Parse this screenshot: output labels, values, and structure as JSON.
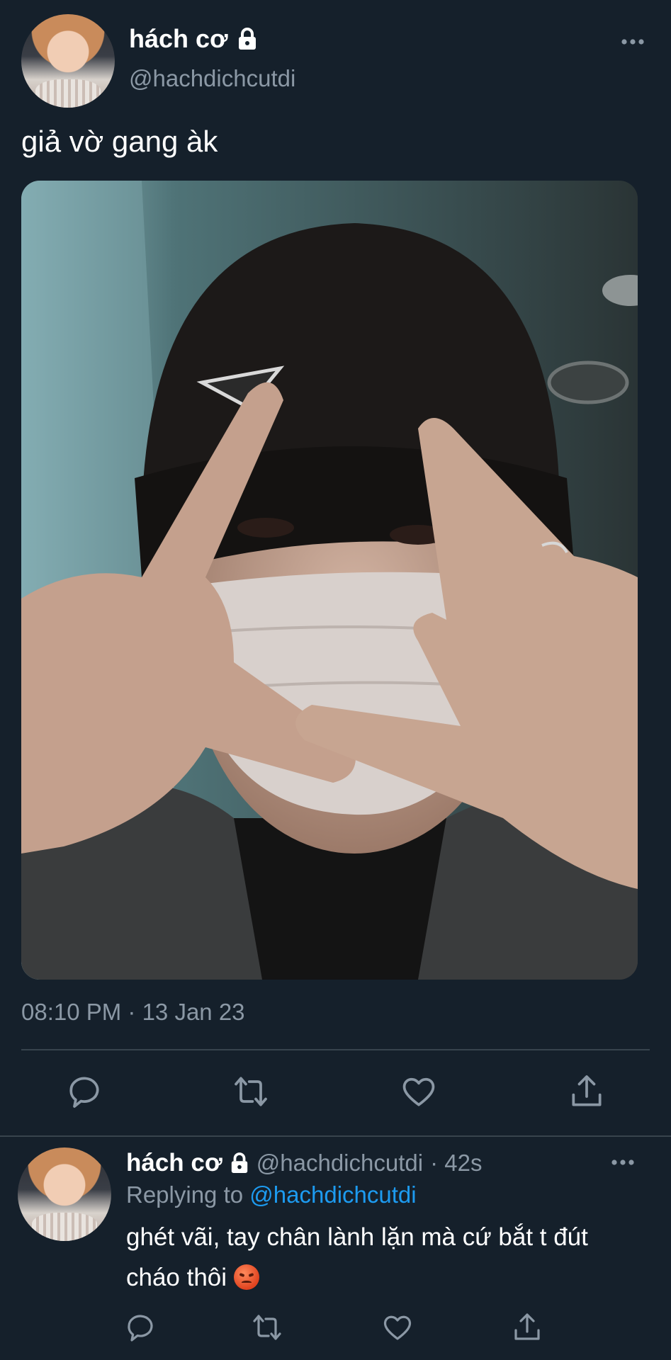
{
  "tweet": {
    "author_name": "hách cơ",
    "author_handle": "@hachdichcutdi",
    "text": "giả vờ gang àk",
    "timestamp": "08:10 PM · 13 Jan 23",
    "media_alt": "selfie photo"
  },
  "reply": {
    "author_name": "hách cơ",
    "author_handle": "@hachdichcutdi",
    "age": "· 42s",
    "replying_prefix": "Replying to",
    "replying_to": "@hachdichcutdi",
    "text_line1": "ghét vãi, tay chân lành lặn mà cứ bắt t đút",
    "text_line2": "cháo thôi"
  },
  "icons": {
    "lock": "lock-icon",
    "more": "more-icon",
    "reply": "reply-icon",
    "retweet": "retweet-icon",
    "like": "like-icon",
    "share": "share-icon",
    "emoji": "angry-face-emoji"
  },
  "colors": {
    "background": "#15202b",
    "secondary_text": "#8b98a5",
    "link": "#1d9bf0",
    "divider": "#38444d"
  }
}
